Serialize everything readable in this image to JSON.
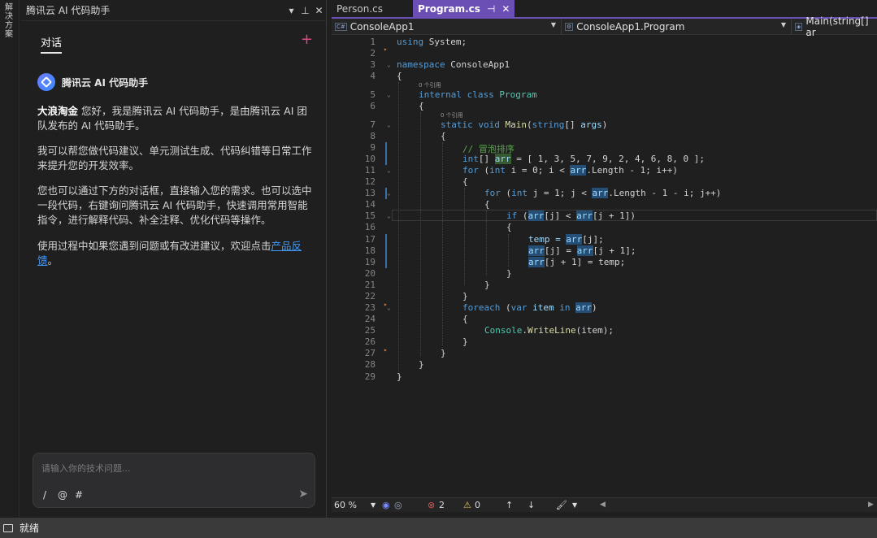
{
  "left_strip": {
    "label": "解决方案"
  },
  "assistant": {
    "title": "腾讯云 AI 代码助手",
    "tab": "对话",
    "bot_name": "腾讯云 AI 代码助手",
    "greeting_name": "大浪淘金",
    "greeting_text": "您好，我是腾讯云 AI 代码助手，是由腾讯云 AI 团队发布的 AI 代码助手。",
    "p2": "我可以帮您做代码建议、单元测试生成、代码纠错等日常工作来提升您的开发效率。",
    "p3": "您也可以通过下方的对话框，直接输入您的需求。也可以选中一段代码，右键询问腾讯云 AI 代码助手，快速调用常用智能指令，进行解释代码、补全注释、优化代码等操作。",
    "p4_prefix": "使用过程中如果您遇到问题或有改进建议，欢迎点击",
    "p4_link": "产品反馈",
    "p4_suffix": "。",
    "input_placeholder": "请输入你的技术问题...",
    "sym_slash": "/",
    "sym_at": "@",
    "sym_hash": "#"
  },
  "editor": {
    "tabs": [
      {
        "label": "Person.cs"
      },
      {
        "label": "Program.cs"
      }
    ],
    "nav": {
      "project": "ConsoleApp1",
      "class": "ConsoleApp1.Program",
      "member": "Main(string[] ar"
    },
    "refs_label": "0 个引用",
    "line_numbers": [
      "1",
      "2",
      "3",
      "4",
      "5",
      "6",
      "7",
      "8",
      "9",
      "10",
      "11",
      "12",
      "13",
      "14",
      "15",
      "16",
      "17",
      "18",
      "19",
      "20",
      "21",
      "22",
      "23",
      "24",
      "25",
      "26",
      "27",
      "28",
      "29"
    ],
    "code": {
      "l1_kw": "using",
      "l1_rest": " System;",
      "l3_kw": "namespace",
      "l3_rest": " ConsoleApp1",
      "brace_open": "{",
      "brace_close": "}",
      "l5_kw": "internal class",
      "l5_ty": "Program",
      "l7_kw1": "static void",
      "l7_fn": "Main",
      "l7_kw2": "string",
      "l7_pm": "args",
      "paren_open": "(",
      "paren_close": ")",
      "brackets_sp": "[] ",
      "l9": "// 冒泡排序",
      "l10_kw": "int",
      "l10_arr": "arr",
      "l10_rest": " = [ 1, 3, 5, 7, 9, 2, 4, 6, 8, 0 ];",
      "brackets": "[] ",
      "l11_kw": "for",
      "l11_kw2": "int",
      "l11_a": " i = 0; i < ",
      "l11_arr": "arr",
      "l11_b": ".Length - 1; i++)",
      "l13_kw": "for",
      "l13_kw2": "int",
      "l13_a": " j = 1; j < ",
      "l13_arr": "arr",
      "l13_b": ".Length - 1 - i; j++)",
      "l15_kw": "if",
      "l15_arr1": "arr",
      "l15_a": "[j] < ",
      "l15_arr2": "arr",
      "l15_b": "[j + 1])",
      "l17_a": "temp = ",
      "l17_arr": "arr",
      "l17_b": "[j];",
      "l18_arr1": "arr",
      "l18_a": "[j] = ",
      "l18_arr2": "arr",
      "l18_b": "[j + 1];",
      "l19_arr": "arr",
      "l19_b": "[j + 1] = temp;",
      "l23_kw": "foreach",
      "l23_kw2": "var",
      "l23_a": " item ",
      "l23_kw3": "in",
      "l23_arr": "arr",
      "l25_ty": "Console",
      "l25_fn": "WriteLine",
      "l25_b": "(item);"
    }
  },
  "editor_status": {
    "zoom": "60 %",
    "errors": "2",
    "warnings": "0"
  },
  "app_status": {
    "text": "就绪"
  },
  "colors": {
    "accent": "#6b4fb5",
    "keyword": "#569cd6",
    "type": "#4ec9b0",
    "function": "#dcdcaa",
    "comment": "#57a64a",
    "link": "#3f9bff"
  }
}
